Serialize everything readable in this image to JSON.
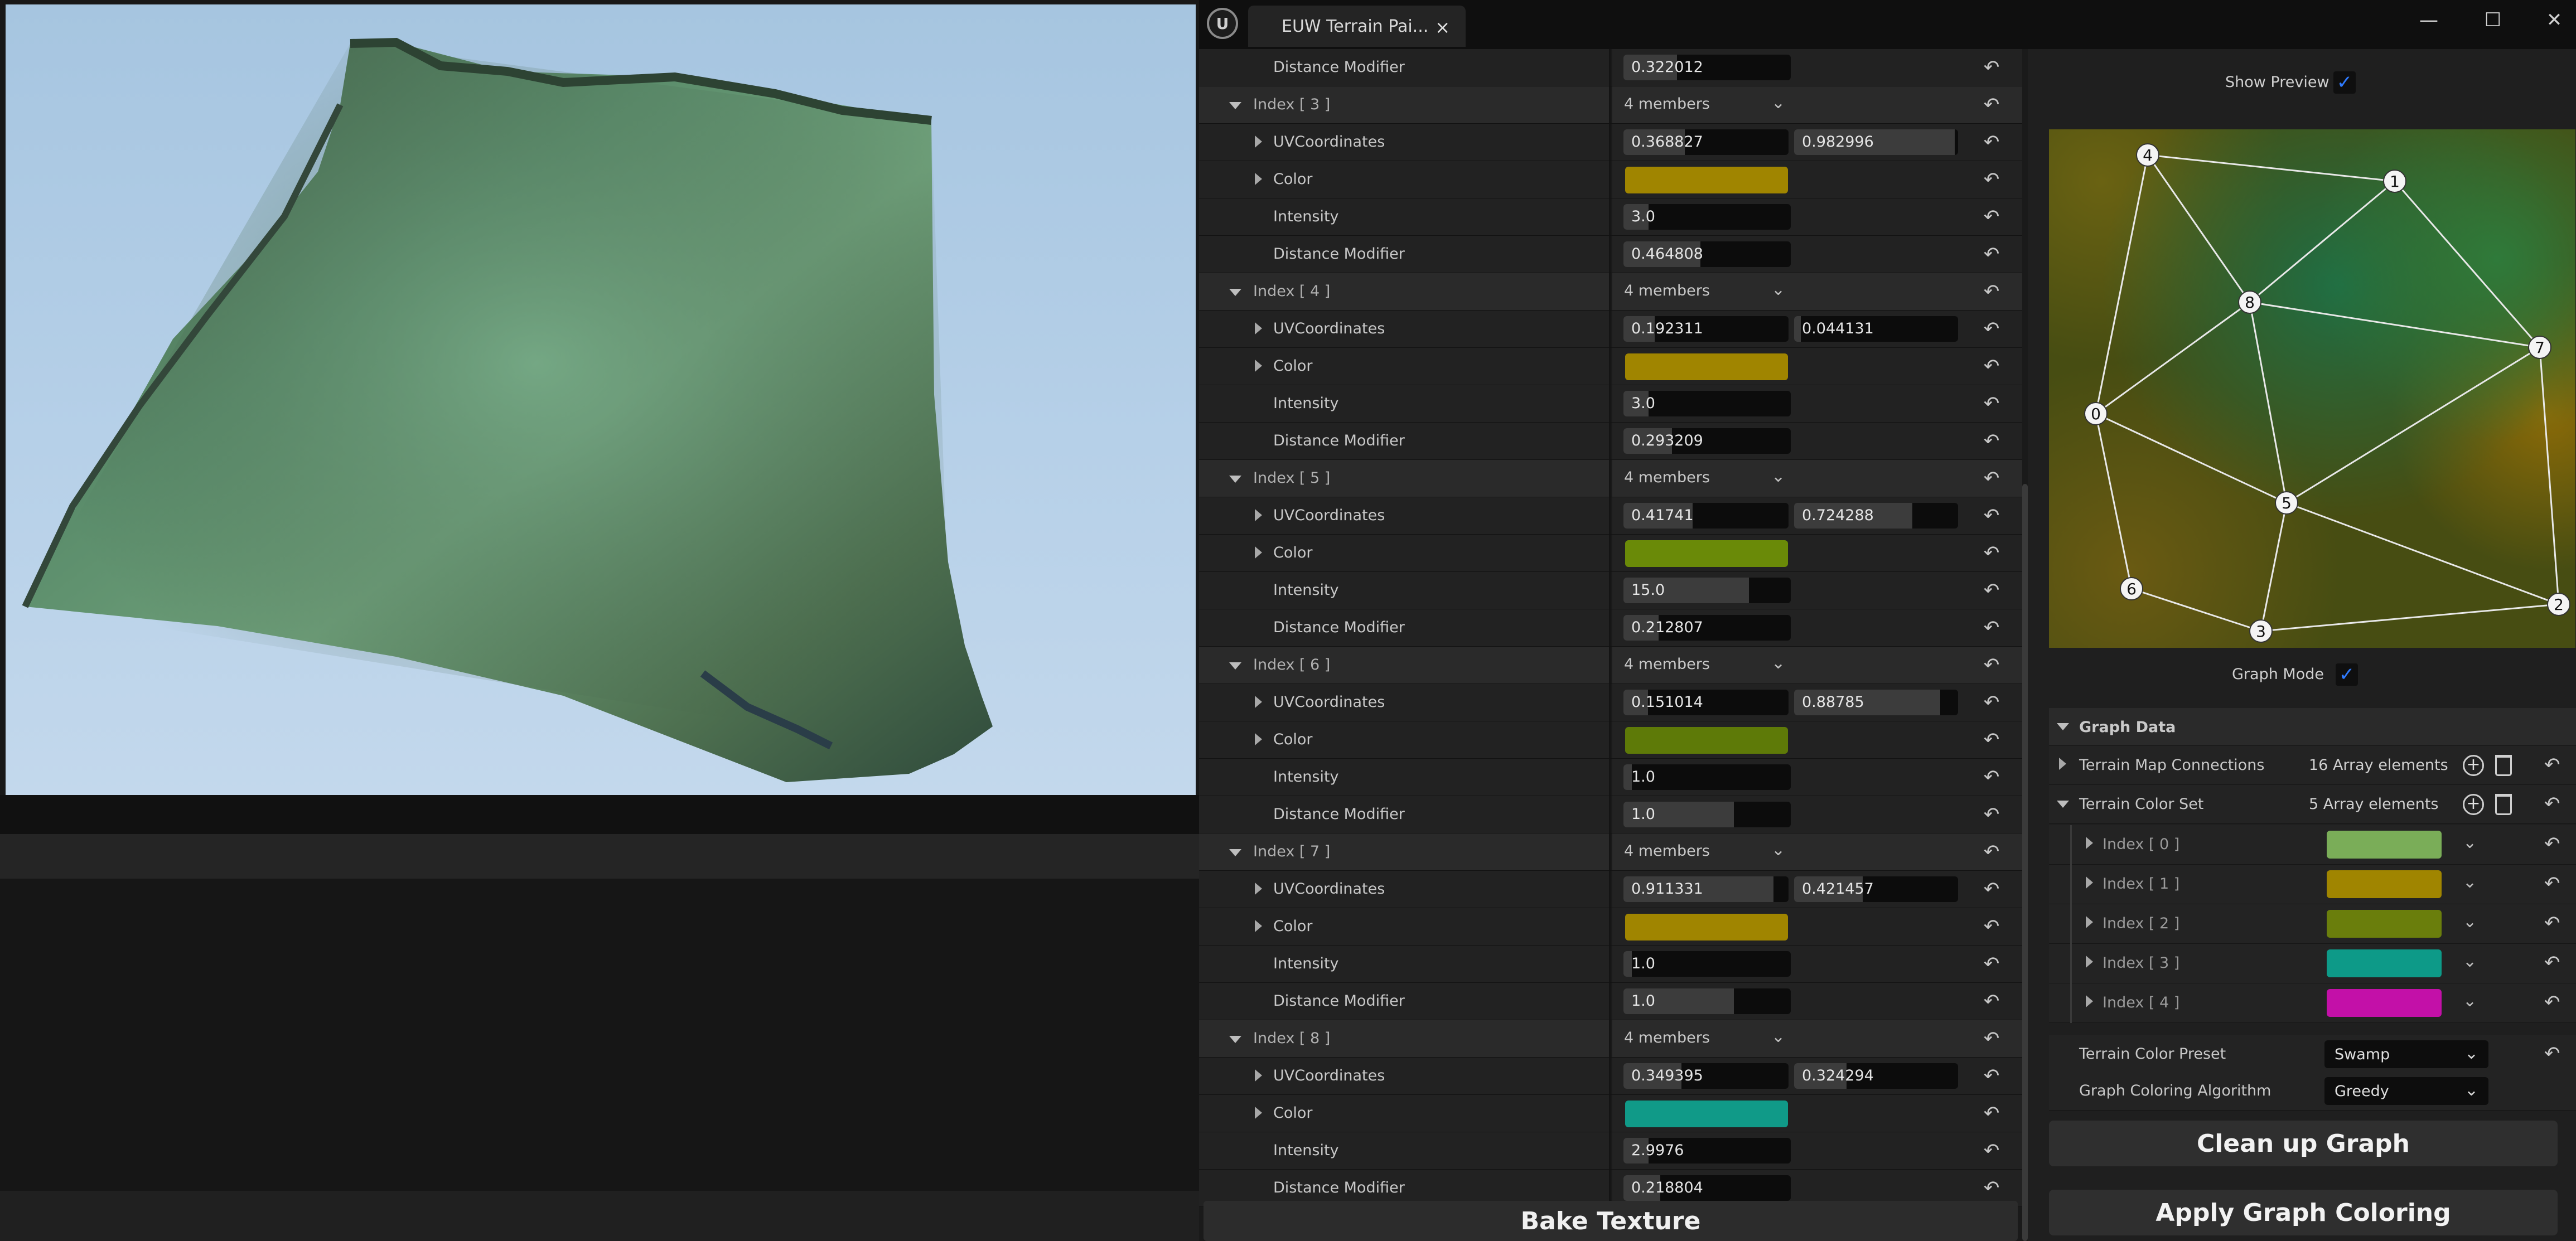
{
  "window": {
    "tab_title": "EUW Terrain Pai...",
    "close_glyph": "×",
    "minimize_glyph": "—",
    "maximize_glyph": "☐",
    "exit_glyph": "✕",
    "logo_glyph": "U"
  },
  "details": {
    "top_row": {
      "label": "Distance Modifier",
      "value": "0.322012",
      "fill": 0.32
    },
    "groups": [
      {
        "index_label": "Index [ 3 ]",
        "members": "4 members",
        "uv": [
          "0.368827",
          "0.982996"
        ],
        "uv_fill": [
          0.37,
          0.98
        ],
        "color": "#a08500",
        "intensity": "3.0",
        "intensity_fill": 0.15,
        "distance": "0.464808",
        "distance_fill": 0.46
      },
      {
        "index_label": "Index [ 4 ]",
        "members": "4 members",
        "uv": [
          "0.192311",
          "0.044131"
        ],
        "uv_fill": [
          0.19,
          0.04
        ],
        "color": "#a08500",
        "intensity": "3.0",
        "intensity_fill": 0.15,
        "distance": "0.293209",
        "distance_fill": 0.29
      },
      {
        "index_label": "Index [ 5 ]",
        "members": "4 members",
        "uv": [
          "0.41741",
          "0.724288"
        ],
        "uv_fill": [
          0.42,
          0.72
        ],
        "color": "#6a8a08",
        "intensity": "15.0",
        "intensity_fill": 0.75,
        "distance": "0.212807",
        "distance_fill": 0.21
      },
      {
        "index_label": "Index [ 6 ]",
        "members": "4 members",
        "uv": [
          "0.151014",
          "0.88785"
        ],
        "uv_fill": [
          0.15,
          0.89
        ],
        "color": "#5e7a08",
        "intensity": "1.0",
        "intensity_fill": 0.05,
        "distance": "1.0",
        "distance_fill": 0.66
      },
      {
        "index_label": "Index [ 7 ]",
        "members": "4 members",
        "uv": [
          "0.911331",
          "0.421457"
        ],
        "uv_fill": [
          0.91,
          0.42
        ],
        "color": "#a08500",
        "intensity": "1.0",
        "intensity_fill": 0.05,
        "distance": "1.0",
        "distance_fill": 0.66
      },
      {
        "index_label": "Index [ 8 ]",
        "members": "4 members",
        "uv": [
          "0.349395",
          "0.324294"
        ],
        "uv_fill": [
          0.35,
          0.32
        ],
        "color": "#109a88",
        "intensity": "2.9976",
        "intensity_fill": 0.15,
        "distance": "0.218804",
        "distance_fill": 0.22
      }
    ],
    "row_labels": {
      "uv": "UVCoordinates",
      "color": "Color",
      "intensity": "Intensity",
      "distance": "Distance Modifier"
    },
    "reset_glyph": "↶",
    "chevron_glyph": "⌄",
    "bake_button": "Bake Texture"
  },
  "preview": {
    "show_preview_label": "Show Preview",
    "show_preview_checked": true,
    "graph_mode_label": "Graph Mode",
    "graph_mode_checked": true,
    "check_glyph": "✓",
    "node_labels": [
      "0",
      "1",
      "2",
      "3",
      "4",
      "5",
      "6",
      "7",
      "8"
    ]
  },
  "graph_data": {
    "header": "Graph Data",
    "connections_label": "Terrain Map Connections",
    "connections_value": "16 Array elements",
    "color_set_label": "Terrain Color Set",
    "color_set_value": "5 Array elements",
    "add_glyph": "+",
    "color_set": [
      {
        "label": "Index [ 0 ]",
        "color": "#7aad58"
      },
      {
        "label": "Index [ 1 ]",
        "color": "#a08500"
      },
      {
        "label": "Index [ 2 ]",
        "color": "#6a7e0c"
      },
      {
        "label": "Index [ 3 ]",
        "color": "#0d9a88"
      },
      {
        "label": "Index [ 4 ]",
        "color": "#c310a8"
      }
    ],
    "preset_label": "Terrain Color Preset",
    "preset_value": "Swamp",
    "algorithm_label": "Graph Coloring Algorithm",
    "algorithm_value": "Greedy"
  },
  "actions": {
    "cleanup_button": "Clean up Graph",
    "apply_button": "Apply Graph Coloring"
  }
}
